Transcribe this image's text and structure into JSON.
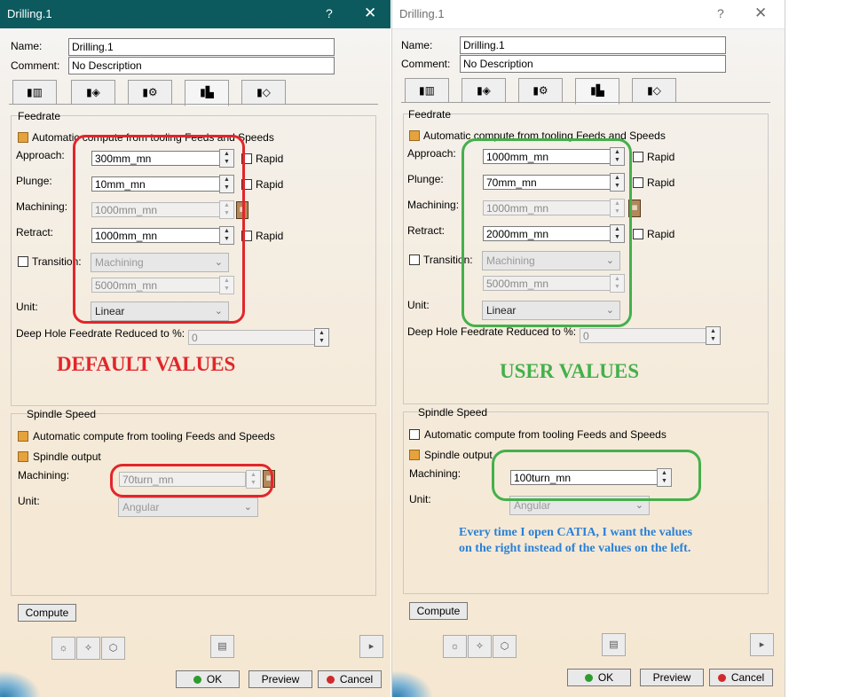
{
  "dialog": {
    "title": "Drilling.1",
    "help": "?",
    "close": "✕",
    "name_label": "Name:",
    "name_value": "Drilling.1",
    "comment_label": "Comment:",
    "comment_value": "No Description",
    "tab_icons": [
      "strategy-tab-icon",
      "geometry-tab-icon",
      "tool-tab-icon",
      "feeds-speeds-tab-icon",
      "macros-tab-icon"
    ],
    "feedrate": {
      "title": "Feedrate",
      "auto_label": "Automatic compute from tooling Feeds and Speeds",
      "approach_label": "Approach:",
      "plunge_label": "Plunge:",
      "machining_label": "Machining:",
      "retract_label": "Retract:",
      "transition_label": "Transition:",
      "rapid_label": "Rapid",
      "transition_mode": "Machining",
      "unit_label": "Unit:",
      "deep_hole_label": "Deep Hole Feedrate Reduced to %:",
      "deep_hole_value": "0"
    },
    "spindle": {
      "title": "Spindle Speed",
      "auto_label": "Automatic compute from tooling Feeds and Speeds",
      "output_label": "Spindle output",
      "machining_label": "Machining:",
      "unit_label": "Unit:"
    },
    "compute_label": "Compute",
    "ok_label": "OK",
    "preview_label": "Preview",
    "cancel_label": "Cancel"
  },
  "left": {
    "approach": "300mm_mn",
    "plunge": "10mm_mn",
    "machining": "1000mm_mn",
    "retract": "1000mm_mn",
    "transition_value": "5000mm_mn",
    "unit": "Linear",
    "spindle_machining": "70turn_mn",
    "spindle_unit": "Angular",
    "spindle_auto_checked": true,
    "annotation": "DEFAULT VALUES"
  },
  "right": {
    "approach": "1000mm_mn",
    "plunge": "70mm_mn",
    "machining": "1000mm_mn",
    "retract": "2000mm_mn",
    "transition_value": "5000mm_mn",
    "unit": "Linear",
    "spindle_machining": "100turn_mn",
    "spindle_unit": "Angular",
    "spindle_auto_checked": false,
    "annotation": "USER VALUES",
    "note": "Every time I open CATIA, I want the values on the right instead of the values on the left."
  },
  "colors": {
    "annotation_red": "#e2262b",
    "annotation_green": "#44b04b",
    "note_blue": "#2a80d6",
    "titlebar_active": "#0c5a5e"
  }
}
